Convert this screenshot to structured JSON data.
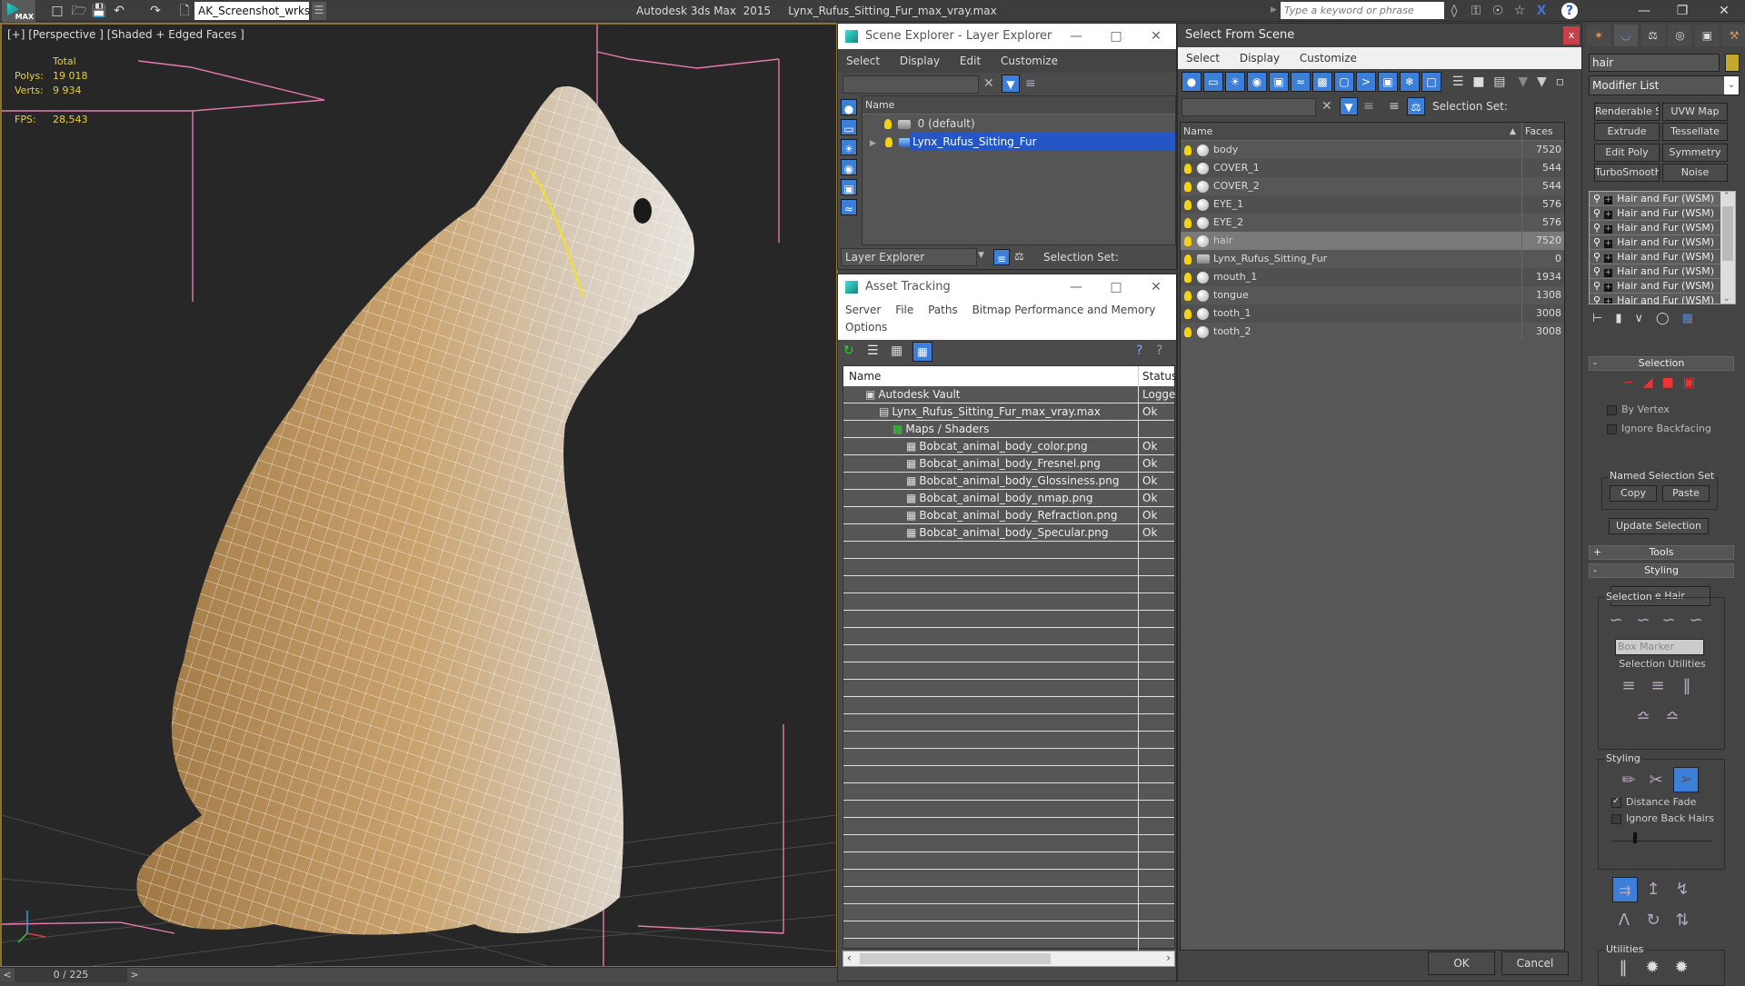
{
  "app": {
    "title": "Autodesk 3ds Max  2015     Lynx_Rufus_Sitting_Fur_max_vray.max",
    "logo_label": "MAX",
    "workspace": "AK_Screenshot_wrksp",
    "search_placeholder": "Type a keyword or phrase"
  },
  "viewport": {
    "label": "[+] [Perspective ] [Shaded + Edged Faces ]",
    "stats": {
      "total_label": "Total",
      "polys_label": "Polys:",
      "polys_value": "19 018",
      "verts_label": "Verts:",
      "verts_value": "9 934",
      "fps_label": "FPS:",
      "fps_value": "28,543"
    },
    "time_slider": "0 / 225",
    "time_prev": "<",
    "time_next": ">"
  },
  "scene_explorer": {
    "title": "Scene Explorer - Layer Explorer",
    "menu": [
      "Select",
      "Display",
      "Edit",
      "Customize"
    ],
    "column_name": "Name",
    "layers": [
      {
        "name": "0 (default)",
        "selected": false
      },
      {
        "name": "Lynx_Rufus_Sitting_Fur",
        "selected": true
      }
    ],
    "footer_mode": "Layer Explorer",
    "selection_set_label": "Selection Set:"
  },
  "asset_tracking": {
    "title": "Asset Tracking",
    "menu": [
      "Server",
      "File",
      "Paths",
      "Bitmap Performance and Memory",
      "Options"
    ],
    "columns": [
      "Name",
      "Status"
    ],
    "rows": [
      {
        "name": "Autodesk Vault",
        "status": "Logged",
        "indent": 0
      },
      {
        "name": "Lynx_Rufus_Sitting_Fur_max_vray.max",
        "status": "Ok",
        "indent": 1
      },
      {
        "name": "Maps / Shaders",
        "status": "",
        "indent": 2
      },
      {
        "name": "Bobcat_animal_body_color.png",
        "status": "Ok",
        "indent": 3
      },
      {
        "name": "Bobcat_animal_body_Fresnel.png",
        "status": "Ok",
        "indent": 3
      },
      {
        "name": "Bobcat_animal_body_Glossiness.png",
        "status": "Ok",
        "indent": 3
      },
      {
        "name": "Bobcat_animal_body_nmap.png",
        "status": "Ok",
        "indent": 3
      },
      {
        "name": "Bobcat_animal_body_Refraction.png",
        "status": "Ok",
        "indent": 3
      },
      {
        "name": "Bobcat_animal_body_Specular.png",
        "status": "Ok",
        "indent": 3
      }
    ]
  },
  "select_from_scene": {
    "title": "Select From Scene",
    "close": "x",
    "menu": [
      "Select",
      "Display",
      "Customize"
    ],
    "selection_set_label": "Selection Set:",
    "columns": [
      "Name",
      "Faces"
    ],
    "objects": [
      {
        "name": "body",
        "faces": "7520",
        "selected": false
      },
      {
        "name": "COVER_1",
        "faces": "544",
        "selected": false
      },
      {
        "name": "COVER_2",
        "faces": "544",
        "selected": false
      },
      {
        "name": "EYE_1",
        "faces": "576",
        "selected": false
      },
      {
        "name": "EYE_2",
        "faces": "576",
        "selected": false
      },
      {
        "name": "hair",
        "faces": "7520",
        "selected": true
      },
      {
        "name": "Lynx_Rufus_Sitting_Fur",
        "faces": "0",
        "selected": false
      },
      {
        "name": "mouth_1",
        "faces": "1934",
        "selected": false
      },
      {
        "name": "tongue",
        "faces": "1308",
        "selected": false
      },
      {
        "name": "tooth_1",
        "faces": "3008",
        "selected": false
      },
      {
        "name": "tooth_2",
        "faces": "3008",
        "selected": false
      }
    ],
    "ok_label": "OK",
    "cancel_label": "Cancel"
  },
  "command_panel": {
    "object_name": "hair",
    "object_color": "#c4aa2c",
    "modifier_list": "Modifier List",
    "modifier_buttons": [
      "Renderable Spline",
      "UVW Map",
      "Extrude",
      "Tessellate",
      "Edit Poly",
      "Symmetry",
      "TurboSmooth",
      "Noise"
    ],
    "stack": [
      "Hair and Fur (WSM)",
      "Hair and Fur (WSM)",
      "Hair and Fur (WSM)",
      "Hair and Fur (WSM)",
      "Hair and Fur (WSM)",
      "Hair and Fur (WSM)",
      "Hair and Fur (WSM)",
      "Hair and Fur (WSM)"
    ],
    "selection_rollout": {
      "title": "Selection",
      "by_vertex": "By Vertex",
      "ignore_backfacing": "Ignore Backfacing",
      "named_set": "Named Selection Set",
      "copy": "Copy",
      "paste": "Paste",
      "update": "Update Selection"
    },
    "tools_rollout": "Tools",
    "styling_rollout": {
      "title": "Styling",
      "style_hair": "Style Hair",
      "selection_group": "Selection",
      "marker": "Box Marker",
      "utilities_label": "Selection Utilities",
      "styling_group": "Styling",
      "distance_fade": "Distance Fade",
      "distance_fade_checked": true,
      "ignore_back_hairs": "Ignore Back Hairs",
      "ignore_back_hairs_checked": false,
      "utilities_group": "Utilities"
    }
  }
}
